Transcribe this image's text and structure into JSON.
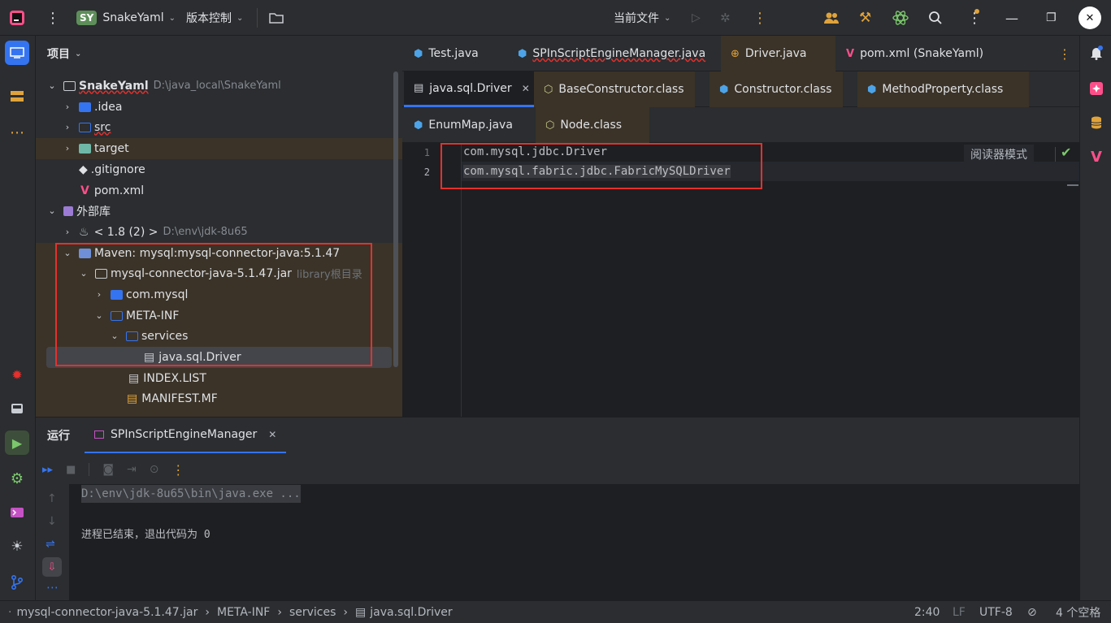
{
  "titlebar": {
    "project_badge": "SY",
    "project_name": "SnakeYaml",
    "vcs_label": "版本控制",
    "run_config": "当前文件"
  },
  "project_panel": {
    "title": "项目",
    "tree": [
      {
        "label": "SnakeYaml",
        "suffix": "D:\\java_local\\SnakeYaml"
      },
      {
        "label": ".idea"
      },
      {
        "label": "src"
      },
      {
        "label": "target"
      },
      {
        "label": ".gitignore"
      },
      {
        "label": "pom.xml"
      },
      {
        "label": "外部库"
      },
      {
        "label": "< 1.8 (2) >",
        "suffix": "D:\\env\\jdk-8u65"
      },
      {
        "label": "Maven: mysql:mysql-connector-java:5.1.47"
      },
      {
        "label": "mysql-connector-java-5.1.47.jar",
        "suffix": "library根目录"
      },
      {
        "label": "com.mysql"
      },
      {
        "label": "META-INF"
      },
      {
        "label": "services"
      },
      {
        "label": "java.sql.Driver"
      },
      {
        "label": "INDEX.LIST"
      },
      {
        "label": "MANIFEST.MF"
      }
    ]
  },
  "editor": {
    "tabs_row1": [
      "Test.java",
      "SPInScriptEngineManager.java",
      "Driver.java",
      "pom.xml (SnakeYaml)"
    ],
    "tabs_row2": [
      "java.sql.Driver",
      "BaseConstructor.class",
      "Constructor.class",
      "MethodProperty.class"
    ],
    "tabs_row3": [
      "EnumMap.java",
      "Node.class"
    ],
    "reader_mode": "阅读器模式",
    "lines": [
      {
        "n": "1",
        "text": "com.mysql.jdbc.Driver"
      },
      {
        "n": "2",
        "text": "com.mysql.fabric.jdbc.FabricMySQLDriver"
      }
    ]
  },
  "run_panel": {
    "title": "运行",
    "tab": "SPInScriptEngineManager",
    "console": [
      "D:\\env\\jdk-8u65\\bin\\java.exe ...",
      "进程已结束，退出代码为 0"
    ]
  },
  "statusbar": {
    "breadcrumb": [
      "mysql-connector-java-5.1.47.jar",
      "META-INF",
      "services",
      "java.sql.Driver"
    ],
    "position": "2:40",
    "line_sep": "LF",
    "encoding": "UTF-8",
    "indent": "4 个空格"
  },
  "colors": {
    "accent": "#3574f0",
    "highlight_box": "#e5302d",
    "hot_row": "#3b3328"
  }
}
